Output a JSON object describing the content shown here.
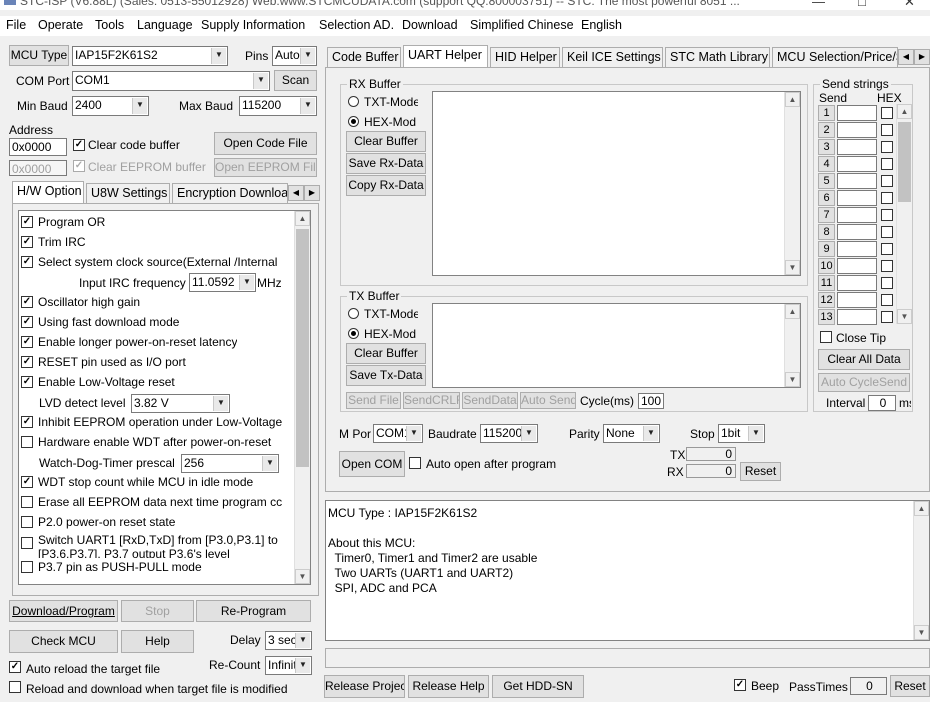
{
  "window": {
    "title": "STC-ISP (V6.88L) (Sales: 0513-55012928) Web:www.STCMCUDATA.com  (support QQ:800003751) -- STC: The most powerful 8051 ..."
  },
  "menu": [
    "File",
    "Operate",
    "Tools",
    "Language",
    "Supply Information",
    "Selection AD.",
    "Download",
    "Simplified Chinese",
    "English"
  ],
  "left": {
    "mcu_type_label": "MCU Type",
    "mcu_type_value": "IAP15F2K61S2",
    "pins_label": "Pins",
    "pins_value": "Auto",
    "com_port_label": "COM Port",
    "com_port_value": "COM1",
    "scan": "Scan",
    "min_baud_label": "Min Baud",
    "min_baud_value": "2400",
    "max_baud_label": "Max Baud",
    "max_baud_value": "115200",
    "address_label": "Address",
    "address_value": "0x0000",
    "address2_value": "0x0000",
    "clear_code_buffer": "Clear code buffer",
    "open_code_file": "Open Code File",
    "clear_eeprom_buffer": "Clear EEPROM buffer",
    "open_eeprom_file": "Open EEPROM File",
    "tabs": [
      "H/W Option",
      "U8W Settings",
      "Encryption Downloa"
    ],
    "options": {
      "program_or": "Program OR",
      "trim_irc": "Trim IRC",
      "select_clock": "Select system clock source(External /Internal",
      "input_irc_label": "Input IRC frequency",
      "irc_value": "11.0592",
      "mhz": "MHz",
      "osc_gain": "Oscillator high gain",
      "fast_download": "Using fast download mode",
      "longer_latency": "Enable longer power-on-reset latency",
      "reset_io": "RESET pin used as I/O port",
      "low_voltage": "Enable Low-Voltage reset",
      "lvd_label": "LVD detect level",
      "lvd_value": "3.82 V",
      "inhibit_eeprom": "Inhibit EEPROM operation under Low-Voltage",
      "hw_wdt": "Hardware enable WDT after power-on-reset",
      "wdt_prescale_label": "Watch-Dog-Timer prescal",
      "wdt_prescale_value": "256",
      "wdt_stop": "WDT stop count while MCU in idle mode",
      "erase_eeprom": "Erase all EEPROM data next time program cc",
      "p20_state": "P2.0 power-on reset state",
      "switch_uart_1": "Switch UART1 [RxD,TxD] from [P3.0,P3.1] to",
      "switch_uart_2": "[P3.6,P3.7], P3.7 output P3.6's level",
      "p37_pushpull": "P3.7 pin as PUSH-PULL mode"
    },
    "download_program": "Download/Program",
    "stop": "Stop",
    "re_program": "Re-Program",
    "check_mcu": "Check MCU",
    "help": "Help",
    "delay_label": "Delay",
    "delay_value": "3 sec",
    "auto_reload": "Auto reload the target file",
    "recount_label": "Re-Count",
    "recount_value": "Infinit",
    "reload_modified": "Reload and download when target file is modified"
  },
  "right": {
    "tabs": [
      "Code Buffer",
      "UART Helper",
      "HID Helper",
      "Keil ICE Settings",
      "STC Math Library",
      "MCU Selection/Price/S"
    ],
    "rx": {
      "title": "RX Buffer",
      "txt_mode": "TXT-Mode",
      "hex_mode": "HEX-Mod",
      "clear": "Clear Buffer",
      "save": "Save Rx-Data",
      "copy": "Copy Rx-Data"
    },
    "tx": {
      "title": "TX Buffer",
      "txt_mode": "TXT-Mode",
      "hex_mode": "HEX-Mod",
      "clear": "Clear Buffer",
      "save": "Save Tx-Data"
    },
    "send_file": "Send File",
    "send_crlf": "SendCRLF",
    "send_data": "SendData",
    "auto_send": "Auto Send",
    "cycle_label": "Cycle(ms)",
    "cycle_value": "100",
    "send_strings": {
      "title": "Send strings",
      "send_hdr": "Send",
      "hex_hdr": "HEX",
      "rows": [
        "1",
        "2",
        "3",
        "4",
        "5",
        "6",
        "7",
        "8",
        "9",
        "10",
        "11",
        "12",
        "13"
      ]
    },
    "close_tip": "Close Tip",
    "clear_all_data": "Clear All Data",
    "auto_cycle_send": "Auto CycleSend",
    "interval_label": "Interval",
    "interval_value": "0",
    "interval_unit": "ms",
    "com_port_label": "M Port",
    "com_port_value": "COM1",
    "baudrate_label": "Baudrate",
    "baudrate_value": "115200",
    "parity_label": "Parity",
    "parity_value": "None",
    "stop_label": "Stop",
    "stop_value": "1bit",
    "open_com": "Open COM",
    "auto_open": "Auto open after program",
    "tx_label": "TX",
    "tx_value": "0",
    "rx_label": "RX",
    "rx_value": "0",
    "reset": "Reset",
    "info": [
      "MCU Type : IAP15F2K61S2",
      "",
      "About this MCU:",
      "  Timer0, Timer1 and Timer2 are usable",
      "  Two UARTs (UART1 and UART2)",
      "  SPI, ADC and PCA"
    ],
    "release_project": "Release Project",
    "release_help": "Release Help",
    "get_hdd_sn": "Get HDD-SN",
    "beep": "Beep",
    "pass_times_label": "PassTimes",
    "pass_times_value": "0",
    "bottom_reset": "Reset"
  }
}
